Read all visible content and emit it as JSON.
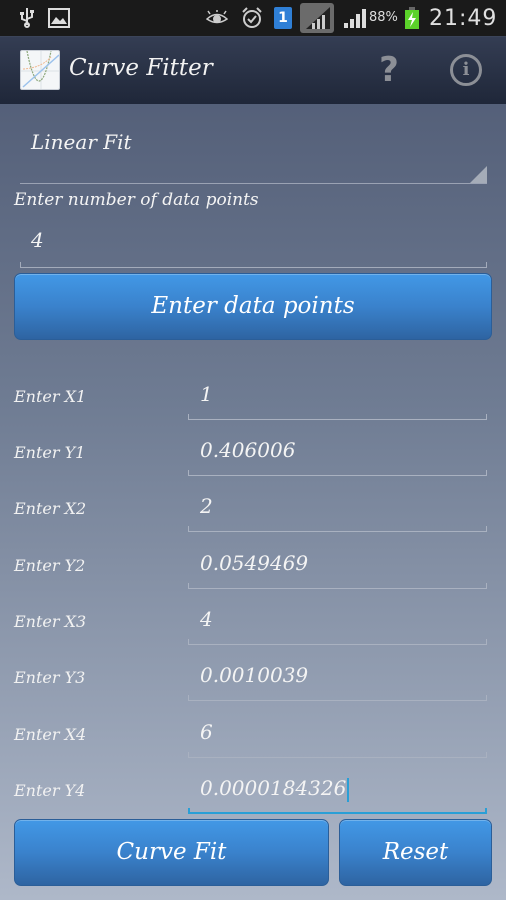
{
  "status_bar": {
    "icons_left": [
      "usb-icon",
      "image-icon"
    ],
    "icons_right": [
      "eye-icon",
      "alarm-icon",
      "notification-1-icon",
      "no-signal-icon",
      "signal-icon",
      "battery-charging-icon"
    ],
    "notification_count": "1",
    "battery_percent": "88%",
    "time": "21:49"
  },
  "action_bar": {
    "title": "Curve Fitter",
    "help_label": "?",
    "info_label": "i"
  },
  "form": {
    "fit_type": "Linear Fit",
    "num_points_label": "Enter number of data points",
    "num_points_value": "4",
    "enter_button": "Enter data points",
    "points": [
      {
        "label": "Enter X1",
        "value": "1"
      },
      {
        "label": "Enter Y1",
        "value": "0.406006"
      },
      {
        "label": "Enter X2",
        "value": "2"
      },
      {
        "label": "Enter Y2",
        "value": "0.0549469"
      },
      {
        "label": "Enter X3",
        "value": "4"
      },
      {
        "label": "Enter Y3",
        "value": "0.0010039"
      },
      {
        "label": "Enter X4",
        "value": "6"
      },
      {
        "label": "Enter Y4",
        "value": "0.0000184326"
      }
    ],
    "curve_fit_button": "Curve Fit",
    "reset_button": "Reset"
  },
  "colors": {
    "button_blue": "#3a82cc",
    "focus_blue": "#2a9fd6",
    "action_bar": "#283046"
  }
}
